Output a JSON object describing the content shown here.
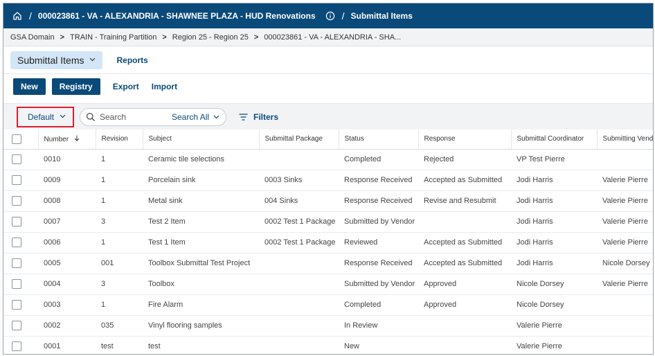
{
  "topbar": {
    "project": "000023861 - VA - ALEXANDRIA - SHAWNEE PLAZA - HUD Renovations",
    "page": "Submittal Items",
    "slash": "/"
  },
  "breadcrumb": [
    "GSA Domain",
    "TRAIN - Training Partition",
    "Region 25 - Region 25",
    "000023861 - VA - ALEXANDRIA - SHA..."
  ],
  "subnav": {
    "active_tab": "Submittal Items",
    "reports": "Reports"
  },
  "toolbar": {
    "new": "New",
    "registry": "Registry",
    "export": "Export",
    "import": "Import"
  },
  "filterbar": {
    "view": "Default",
    "search_placeholder": "Search",
    "search_scope": "Search All",
    "filters": "Filters"
  },
  "table": {
    "columns": [
      "Number",
      "Revision",
      "Subject",
      "Submittal Package",
      "Status",
      "Response",
      "Submittal Coordinator",
      "Submitting Vendor"
    ],
    "rows": [
      [
        "0010",
        "1",
        "Ceramic tile selections",
        "",
        "Completed",
        "Rejected",
        "VP Test Pierre",
        ""
      ],
      [
        "0009",
        "1",
        "Porcelain sink",
        "0003 Sinks",
        "Response Received",
        "Accepted as Submitted",
        "Jodi Harris",
        "Valerie Pierre"
      ],
      [
        "0008",
        "1",
        "Metal sink",
        "004 Sinks",
        "Response Received",
        "Revise and Resubmit",
        "Jodi Harris",
        "Valerie Pierre"
      ],
      [
        "0007",
        "3",
        "Test 2 Item",
        "0002 Test 1 Package",
        "Submitted by Vendor",
        "",
        "Jodi Harris",
        "Valerie Pierre"
      ],
      [
        "0006",
        "1",
        "Test 1 Item",
        "0002 Test 1 Package",
        "Reviewed",
        "Accepted as Submitted",
        "Jodi Harris",
        "Valerie Pierre"
      ],
      [
        "0005",
        "001",
        "Toolbox Submittal Test Project",
        "",
        "Response Received",
        "Accepted as Submitted",
        "Jodi Harris",
        "Nicole Dorsey"
      ],
      [
        "0004",
        "3",
        "Toolbox",
        "",
        "Submitted by Vendor",
        "Approved",
        "Nicole Dorsey",
        "Valerie Pierre"
      ],
      [
        "0003",
        "1",
        "Fire Alarm",
        "",
        "Completed",
        "Approved",
        "Nicole Dorsey",
        ""
      ],
      [
        "0002",
        "035",
        "Vinyl flooring samples",
        "",
        "In Review",
        "",
        "Valerie Pierre",
        ""
      ],
      [
        "0001",
        "test",
        "test",
        "",
        "New",
        "",
        "Valerie Pierre",
        ""
      ]
    ]
  },
  "colors": {
    "brand": "#0a4a7a",
    "highlight": "#d9202c",
    "tab_bg": "#d3e6f7"
  },
  "icons": {
    "home": "home-icon",
    "info": "info-icon",
    "search": "search-icon",
    "filter": "filter-icon",
    "sort": "arrow-down-icon",
    "chevron": "chevron-down-icon"
  }
}
